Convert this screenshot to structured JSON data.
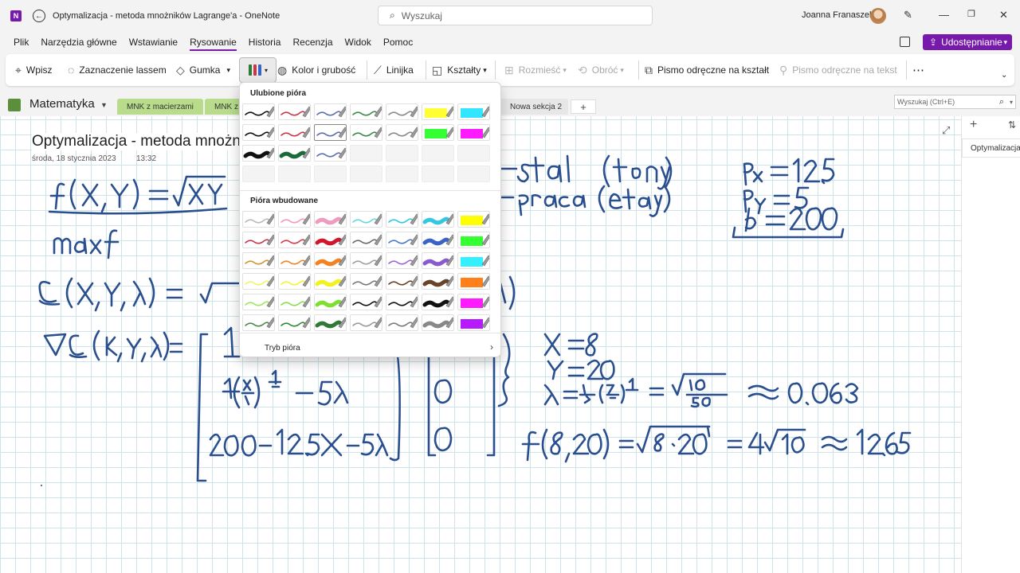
{
  "window": {
    "title": "Optymalizacja - metoda mnożników Lagrange'a  -  OneNote",
    "search_placeholder": "Wyszukaj",
    "user": "Joanna Franaszek"
  },
  "menu": [
    "Plik",
    "Narzędzia główne",
    "Wstawianie",
    "Rysowanie",
    "Historia",
    "Recenzja",
    "Widok",
    "Pomoc"
  ],
  "active_menu": "Rysowanie",
  "share_label": "Udostępnianie",
  "ribbon": {
    "type": "Wpisz",
    "lasso": "Zaznaczenie lassem",
    "eraser": "Gumka",
    "color_width": "Kolor i grubość",
    "ruler": "Linijka",
    "shapes": "Kształty",
    "space": "Rozmieść",
    "rotate": "Obróć",
    "ink_to_shape": "Pismo odręczne na kształt",
    "ink_to_text": "Pismo odręczne na tekst",
    "more": "⋯"
  },
  "notebook": {
    "name": "Matematyka",
    "sections": [
      "MNK z macierzami",
      "MNK z",
      "Nowa sekcja 2"
    ],
    "page_search_placeholder": "Wyszukaj (Ctrl+E)"
  },
  "page": {
    "title": "Optymalizacja - metoda mnożników Lagrange'a",
    "date": "środa, 18 stycznia 2023",
    "time": "13:32"
  },
  "right_pane": {
    "page_label": "Optymalizacja - metoda mnożników Lagrange'a"
  },
  "pen_dropdown": {
    "favorites_label": "Ulubione pióra",
    "builtin_label": "Pióra wbudowane",
    "footer_label": "Tryb pióra",
    "favorites": [
      [
        "#111111",
        "#c8374a",
        "#5a6fae",
        "#3c8a4b",
        "#8a8a8a",
        "hl:#ffff33",
        "hl:#33e6ff"
      ],
      [
        "#111111",
        "#c8374a",
        "#5a6fae",
        "#3c8a4b",
        "#8a8a8a",
        "hl:#33ff33",
        "hl:#ff1aff"
      ],
      [
        "thick:#111111",
        "thick:#1a6b3a",
        "#5a6fae",
        "",
        "",
        "",
        ""
      ],
      [
        "",
        "",
        "",
        "",
        "",
        "",
        ""
      ]
    ],
    "builtin": [
      [
        "#b9b9b9",
        "#f09ac0",
        "thick:#f09ac0",
        "#63d9e0",
        "#35c7e0",
        "thick:#35c7e0",
        "hl:#ffff00"
      ],
      [
        "#c8374a",
        "#d23d4b",
        "thick:#d1162d",
        "#6a6a6a",
        "#4a7bc9",
        "thick:#3a63c9",
        "hl:#33ff33"
      ],
      [
        "#d2962e",
        "#f08428",
        "thick:#f58220",
        "#9f9f9f",
        "#9a6ad1",
        "thick:#8a5ad1",
        "hl:#33f0ff"
      ],
      [
        "#f3f36a",
        "#f3f336",
        "thick:#f2f21d",
        "#7a7a7a",
        "#6a4328",
        "thick:#6a4328",
        "hl:#ff7f1a"
      ],
      [
        "#9be85b",
        "#86e04a",
        "thick:#7de030",
        "#111111",
        "#111111",
        "thick:#111111",
        "hl:#ff1aff"
      ],
      [
        "#4e8a4e",
        "#2f8a3a",
        "thick:#2f7a36",
        "#9a9a9a",
        "#7a7a7a",
        "thick:#888888",
        "hl:#b81aff"
      ]
    ],
    "selected_favorite": [
      1,
      2
    ]
  },
  "colors": {
    "accent": "#7719aa",
    "ink": "#2a4f8f",
    "section_tab": "#b8dc8c"
  }
}
